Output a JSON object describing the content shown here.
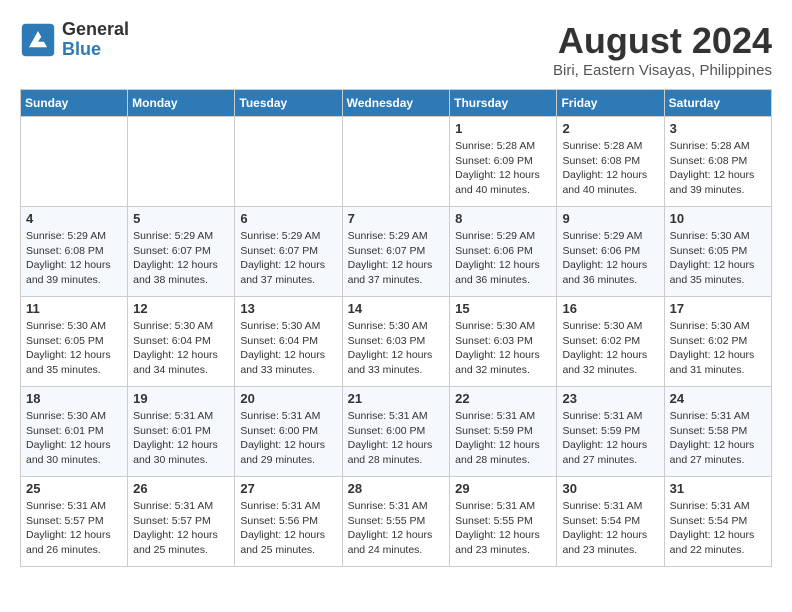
{
  "header": {
    "logo_line1": "General",
    "logo_line2": "Blue",
    "month_year": "August 2024",
    "location": "Biri, Eastern Visayas, Philippines"
  },
  "days_of_week": [
    "Sunday",
    "Monday",
    "Tuesday",
    "Wednesday",
    "Thursday",
    "Friday",
    "Saturday"
  ],
  "weeks": [
    [
      {
        "day": "",
        "info": ""
      },
      {
        "day": "",
        "info": ""
      },
      {
        "day": "",
        "info": ""
      },
      {
        "day": "",
        "info": ""
      },
      {
        "day": "1",
        "info": "Sunrise: 5:28 AM\nSunset: 6:09 PM\nDaylight: 12 hours and 40 minutes."
      },
      {
        "day": "2",
        "info": "Sunrise: 5:28 AM\nSunset: 6:08 PM\nDaylight: 12 hours and 40 minutes."
      },
      {
        "day": "3",
        "info": "Sunrise: 5:28 AM\nSunset: 6:08 PM\nDaylight: 12 hours and 39 minutes."
      }
    ],
    [
      {
        "day": "4",
        "info": "Sunrise: 5:29 AM\nSunset: 6:08 PM\nDaylight: 12 hours and 39 minutes."
      },
      {
        "day": "5",
        "info": "Sunrise: 5:29 AM\nSunset: 6:07 PM\nDaylight: 12 hours and 38 minutes."
      },
      {
        "day": "6",
        "info": "Sunrise: 5:29 AM\nSunset: 6:07 PM\nDaylight: 12 hours and 37 minutes."
      },
      {
        "day": "7",
        "info": "Sunrise: 5:29 AM\nSunset: 6:07 PM\nDaylight: 12 hours and 37 minutes."
      },
      {
        "day": "8",
        "info": "Sunrise: 5:29 AM\nSunset: 6:06 PM\nDaylight: 12 hours and 36 minutes."
      },
      {
        "day": "9",
        "info": "Sunrise: 5:29 AM\nSunset: 6:06 PM\nDaylight: 12 hours and 36 minutes."
      },
      {
        "day": "10",
        "info": "Sunrise: 5:30 AM\nSunset: 6:05 PM\nDaylight: 12 hours and 35 minutes."
      }
    ],
    [
      {
        "day": "11",
        "info": "Sunrise: 5:30 AM\nSunset: 6:05 PM\nDaylight: 12 hours and 35 minutes."
      },
      {
        "day": "12",
        "info": "Sunrise: 5:30 AM\nSunset: 6:04 PM\nDaylight: 12 hours and 34 minutes."
      },
      {
        "day": "13",
        "info": "Sunrise: 5:30 AM\nSunset: 6:04 PM\nDaylight: 12 hours and 33 minutes."
      },
      {
        "day": "14",
        "info": "Sunrise: 5:30 AM\nSunset: 6:03 PM\nDaylight: 12 hours and 33 minutes."
      },
      {
        "day": "15",
        "info": "Sunrise: 5:30 AM\nSunset: 6:03 PM\nDaylight: 12 hours and 32 minutes."
      },
      {
        "day": "16",
        "info": "Sunrise: 5:30 AM\nSunset: 6:02 PM\nDaylight: 12 hours and 32 minutes."
      },
      {
        "day": "17",
        "info": "Sunrise: 5:30 AM\nSunset: 6:02 PM\nDaylight: 12 hours and 31 minutes."
      }
    ],
    [
      {
        "day": "18",
        "info": "Sunrise: 5:30 AM\nSunset: 6:01 PM\nDaylight: 12 hours and 30 minutes."
      },
      {
        "day": "19",
        "info": "Sunrise: 5:31 AM\nSunset: 6:01 PM\nDaylight: 12 hours and 30 minutes."
      },
      {
        "day": "20",
        "info": "Sunrise: 5:31 AM\nSunset: 6:00 PM\nDaylight: 12 hours and 29 minutes."
      },
      {
        "day": "21",
        "info": "Sunrise: 5:31 AM\nSunset: 6:00 PM\nDaylight: 12 hours and 28 minutes."
      },
      {
        "day": "22",
        "info": "Sunrise: 5:31 AM\nSunset: 5:59 PM\nDaylight: 12 hours and 28 minutes."
      },
      {
        "day": "23",
        "info": "Sunrise: 5:31 AM\nSunset: 5:59 PM\nDaylight: 12 hours and 27 minutes."
      },
      {
        "day": "24",
        "info": "Sunrise: 5:31 AM\nSunset: 5:58 PM\nDaylight: 12 hours and 27 minutes."
      }
    ],
    [
      {
        "day": "25",
        "info": "Sunrise: 5:31 AM\nSunset: 5:57 PM\nDaylight: 12 hours and 26 minutes."
      },
      {
        "day": "26",
        "info": "Sunrise: 5:31 AM\nSunset: 5:57 PM\nDaylight: 12 hours and 25 minutes."
      },
      {
        "day": "27",
        "info": "Sunrise: 5:31 AM\nSunset: 5:56 PM\nDaylight: 12 hours and 25 minutes."
      },
      {
        "day": "28",
        "info": "Sunrise: 5:31 AM\nSunset: 5:55 PM\nDaylight: 12 hours and 24 minutes."
      },
      {
        "day": "29",
        "info": "Sunrise: 5:31 AM\nSunset: 5:55 PM\nDaylight: 12 hours and 23 minutes."
      },
      {
        "day": "30",
        "info": "Sunrise: 5:31 AM\nSunset: 5:54 PM\nDaylight: 12 hours and 23 minutes."
      },
      {
        "day": "31",
        "info": "Sunrise: 5:31 AM\nSunset: 5:54 PM\nDaylight: 12 hours and 22 minutes."
      }
    ]
  ]
}
